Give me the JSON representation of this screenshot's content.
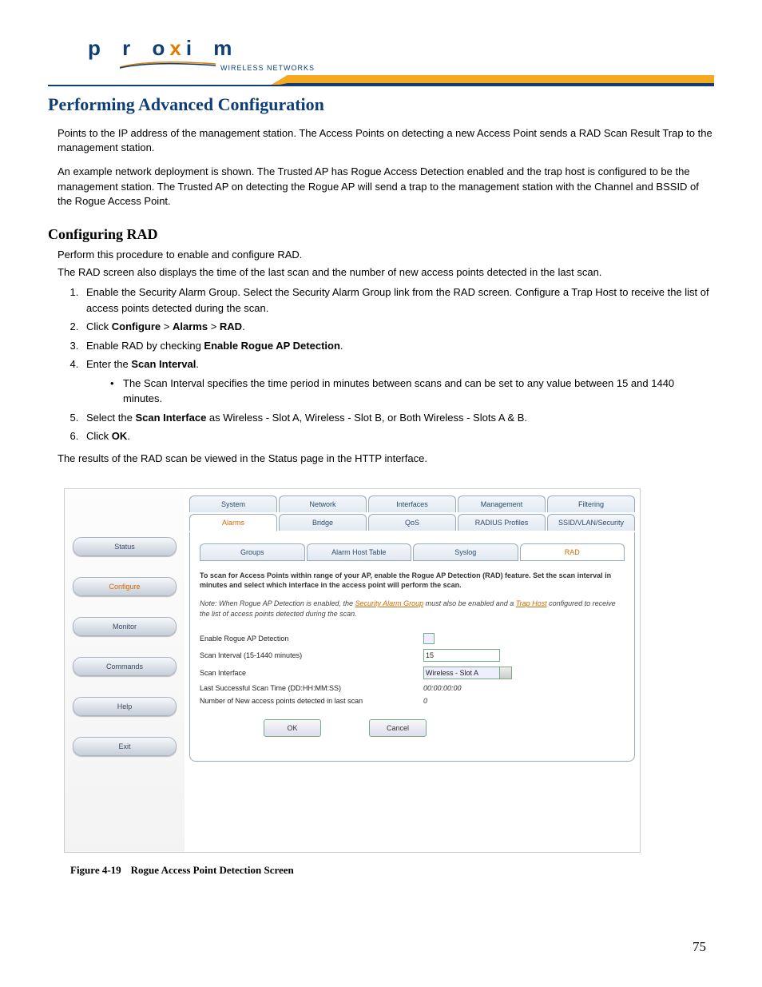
{
  "logo": {
    "brand_left": "p r o",
    "brand_x": "x",
    "brand_right": "i m",
    "sub": "WIRELESS NETWORKS"
  },
  "header": {
    "title": "Performing Advanced Configuration"
  },
  "intro": {
    "p1": "Points to the IP address of the management station. The Access Points on detecting a new Access Point sends a RAD Scan Result Trap to the management station.",
    "p2": "An example network deployment is shown. The Trusted AP has Rogue Access Detection enabled and the trap host is configured to be the management station. The Trusted AP on detecting the Rogue AP will send a trap to the management station with the Channel and BSSID of the Rogue Access Point."
  },
  "section": {
    "title": "Configuring RAD",
    "lead1": "Perform this procedure to enable and configure RAD.",
    "lead2": "The RAD screen also displays the time of the last scan and the number of new access points detected in the last scan.",
    "steps": {
      "s1": "Enable the Security Alarm Group. Select the Security Alarm Group link from the RAD screen. Configure a Trap Host to receive the list of access points detected during the scan.",
      "s2a": "Click ",
      "s2b": "Configure",
      "s2c": " > ",
      "s2d": "Alarms",
      "s2e": " > ",
      "s2f": "RAD",
      "s2g": ".",
      "s3a": "Enable RAD by checking ",
      "s3b": "Enable Rogue AP Detection",
      "s3c": ".",
      "s4a": "Enter the ",
      "s4b": "Scan Interval",
      "s4c": ".",
      "s4bullet": "The Scan Interval specifies the time period in minutes between scans and can be set to any value between 15 and 1440 minutes.",
      "s5a": "Select the ",
      "s5b": "Scan Interface",
      "s5c": " as Wireless - Slot A, Wireless - Slot B, or Both Wireless - Slots A & B.",
      "s6a": "Click ",
      "s6b": "OK",
      "s6c": "."
    },
    "after": "The results of the RAD scan be viewed in the Status page in the HTTP interface."
  },
  "ui": {
    "nav": [
      "Status",
      "Configure",
      "Monitor",
      "Commands",
      "Help",
      "Exit"
    ],
    "tabs_row1": [
      "System",
      "Network",
      "Interfaces",
      "Management",
      "Filtering"
    ],
    "tabs_row2": [
      "Alarms",
      "Bridge",
      "QoS",
      "RADIUS Profiles",
      "SSID/VLAN/Security"
    ],
    "subtabs": [
      "Groups",
      "Alarm Host Table",
      "Syslog",
      "RAD"
    ],
    "desc": "To scan for Access Points within range of your AP, enable the Rogue AP Detection (RAD) feature. Set the scan interval in minutes and select which interface in the access point will perform the scan.",
    "note_a": "Note: When Rogue AP Detection is enabled, the ",
    "note_link1": "Security Alarm Group",
    "note_b": " must also be enabled and a ",
    "note_link2": "Trap Host",
    "note_c": " configured to receive the list of access points detected during the scan.",
    "rows": {
      "r1": "Enable Rogue AP Detection",
      "r2": "Scan Interval (15-1440 minutes)",
      "r2v": "15",
      "r3": "Scan Interface",
      "r3v": "Wireless - Slot A",
      "r4": "Last Successful Scan Time (DD:HH:MM:SS)",
      "r4v": "00:00:00:00",
      "r5": "Number of New access points detected in last scan",
      "r5v": "0"
    },
    "btn_ok": "OK",
    "btn_cancel": "Cancel"
  },
  "caption": {
    "fig": "Figure 4-19",
    "text": "Rogue Access Point Detection Screen"
  },
  "pagenum": "75"
}
